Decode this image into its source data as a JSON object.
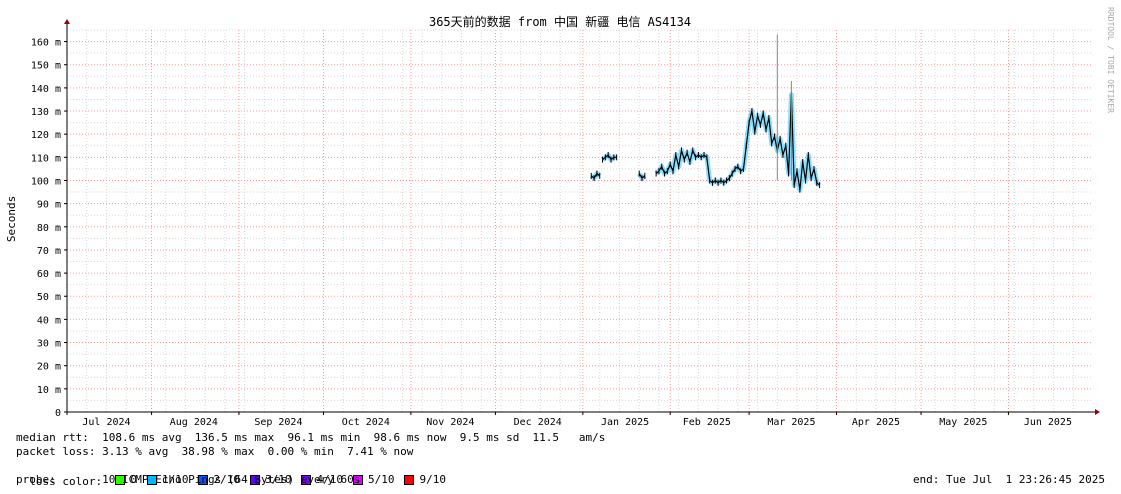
{
  "chart_data": {
    "type": "line",
    "title": "365天前的数据 from 中国 新疆 电信 AS4134",
    "ylabel": "Seconds",
    "watermark": "RRDTOOL / TOBI OETIKER",
    "ylim": [
      0,
      165
    ],
    "yticks": [
      {
        "v": 0,
        "label": "0"
      },
      {
        "v": 10,
        "label": "10 m"
      },
      {
        "v": 20,
        "label": "20 m"
      },
      {
        "v": 30,
        "label": "30 m"
      },
      {
        "v": 40,
        "label": "40 m"
      },
      {
        "v": 50,
        "label": "50 m"
      },
      {
        "v": 60,
        "label": "60 m"
      },
      {
        "v": 70,
        "label": "70 m"
      },
      {
        "v": 80,
        "label": "80 m"
      },
      {
        "v": 90,
        "label": "90 m"
      },
      {
        "v": 100,
        "label": "100 m"
      },
      {
        "v": 110,
        "label": "110 m"
      },
      {
        "v": 120,
        "label": "120 m"
      },
      {
        "v": 130,
        "label": "130 m"
      },
      {
        "v": 140,
        "label": "140 m"
      },
      {
        "v": 150,
        "label": "150 m"
      },
      {
        "v": 160,
        "label": "160 m"
      }
    ],
    "xlim": [
      "2024-07-02",
      "2025-07-01"
    ],
    "month_starts": [
      "2024-07-01",
      "2024-08-01",
      "2024-09-01",
      "2024-10-01",
      "2024-11-01",
      "2024-12-01",
      "2025-01-01",
      "2025-02-01",
      "2025-03-01",
      "2025-04-01",
      "2025-05-01",
      "2025-06-01"
    ],
    "xticks": [
      {
        "date": "2024-07-16",
        "label": "Jul 2024"
      },
      {
        "date": "2024-08-16",
        "label": "Aug 2024"
      },
      {
        "date": "2024-09-15",
        "label": "Sep 2024"
      },
      {
        "date": "2024-10-16",
        "label": "Oct 2024"
      },
      {
        "date": "2024-11-15",
        "label": "Nov 2024"
      },
      {
        "date": "2024-12-16",
        "label": "Dec 2024"
      },
      {
        "date": "2025-01-16",
        "label": "Jan 2025"
      },
      {
        "date": "2025-02-14",
        "label": "Feb 2025"
      },
      {
        "date": "2025-03-16",
        "label": "Mar 2025"
      },
      {
        "date": "2025-04-15",
        "label": "Apr 2025"
      },
      {
        "date": "2025-05-16",
        "label": "May 2025"
      },
      {
        "date": "2025-06-15",
        "label": "Jun 2025"
      }
    ],
    "grid": true,
    "series": [
      {
        "color": "#000000",
        "segments": [
          [
            [
              "2025-01-04",
              102
            ],
            [
              "2025-01-05",
              101
            ],
            [
              "2025-01-06",
              103
            ],
            [
              "2025-01-07",
              102
            ]
          ],
          [
            [
              "2025-01-08",
              109
            ],
            [
              "2025-01-09",
              110
            ],
            [
              "2025-01-10",
              111
            ],
            [
              "2025-01-11",
              109
            ],
            [
              "2025-01-12",
              110
            ],
            [
              "2025-01-13",
              110
            ]
          ],
          [
            [
              "2025-01-21",
              103
            ],
            [
              "2025-01-22",
              101
            ],
            [
              "2025-01-23",
              102
            ]
          ],
          [
            [
              "2025-01-27",
              103
            ],
            [
              "2025-01-28",
              104
            ],
            [
              "2025-01-29",
              106
            ],
            [
              "2025-01-30",
              103
            ],
            [
              "2025-01-31",
              104
            ],
            [
              "2025-02-01",
              107
            ],
            [
              "2025-02-02",
              104
            ],
            [
              "2025-02-03",
              111
            ],
            [
              "2025-02-04",
              106
            ],
            [
              "2025-02-05",
              113
            ],
            [
              "2025-02-06",
              109
            ],
            [
              "2025-02-07",
              112
            ],
            [
              "2025-02-08",
              108
            ],
            [
              "2025-02-09",
              113
            ],
            [
              "2025-02-10",
              110
            ],
            [
              "2025-02-11",
              111
            ],
            [
              "2025-02-12",
              110
            ],
            [
              "2025-02-13",
              111
            ],
            [
              "2025-02-14",
              110
            ],
            [
              "2025-02-15",
              100
            ],
            [
              "2025-02-16",
              99
            ],
            [
              "2025-02-17",
              100
            ],
            [
              "2025-02-18",
              99
            ],
            [
              "2025-02-19",
              100
            ],
            [
              "2025-02-20",
              99
            ],
            [
              "2025-02-21",
              100
            ],
            [
              "2025-02-22",
              101
            ],
            [
              "2025-02-23",
              103
            ],
            [
              "2025-02-24",
              105
            ],
            [
              "2025-02-25",
              106
            ],
            [
              "2025-02-26",
              104
            ],
            [
              "2025-02-27",
              105
            ],
            [
              "2025-02-28",
              115
            ],
            [
              "2025-03-01",
              125
            ],
            [
              "2025-03-02",
              130
            ],
            [
              "2025-03-03",
              121
            ],
            [
              "2025-03-04",
              128
            ],
            [
              "2025-03-05",
              124
            ],
            [
              "2025-03-06",
              129
            ],
            [
              "2025-03-07",
              122
            ],
            [
              "2025-03-08",
              127
            ],
            [
              "2025-03-09",
              116
            ],
            [
              "2025-03-10",
              119
            ],
            [
              "2025-03-11",
              113
            ],
            [
              "2025-03-12",
              118
            ],
            [
              "2025-03-13",
              111
            ],
            [
              "2025-03-14",
              115
            ],
            [
              "2025-03-15",
              103
            ],
            [
              "2025-03-16",
              137
            ],
            [
              "2025-03-17",
              98
            ],
            [
              "2025-03-18",
              104
            ],
            [
              "2025-03-19",
              96
            ],
            [
              "2025-03-20",
              108
            ],
            [
              "2025-03-21",
              100
            ],
            [
              "2025-03-22",
              111
            ],
            [
              "2025-03-23",
              101
            ],
            [
              "2025-03-24",
              105
            ],
            [
              "2025-03-25",
              99
            ],
            [
              "2025-03-26",
              98
            ]
          ]
        ]
      }
    ],
    "spikes": [
      {
        "date": "2025-03-11",
        "value": 163
      },
      {
        "date": "2025-03-16",
        "value": 143
      }
    ]
  },
  "footer": {
    "median_rtt": "median rtt:  108.6 ms avg  136.5 ms max  96.1 ms min  98.6 ms now  9.5 ms sd  11.5   am/s",
    "packet_loss": "packet loss: 3.13 % avg  38.98 % max  0.00 % min  7.41 % now",
    "loss_color_label": "loss color:",
    "loss_colors": [
      {
        "label": "0",
        "color": "#26ff00"
      },
      {
        "label": "1/10",
        "color": "#00b8ff"
      },
      {
        "label": "2/10",
        "color": "#0059ff"
      },
      {
        "label": "3/10",
        "color": "#5e00ff"
      },
      {
        "label": "4/10",
        "color": "#7e00ff"
      },
      {
        "label": "5/10",
        "color": "#dd00ff"
      },
      {
        "label": "9/10",
        "color": "#ff0000"
      }
    ],
    "probe": "probe:       10 ICMP Echo Pings (64 Bytes) every 60s",
    "end": "end: Tue Jul  1 23:26:45 2025"
  },
  "colors": {
    "grid_major": "#ff9999",
    "grid_minor": "#d8d8d8",
    "axis": "#000000",
    "arrow": "#990000",
    "band": "#00b8ff"
  }
}
